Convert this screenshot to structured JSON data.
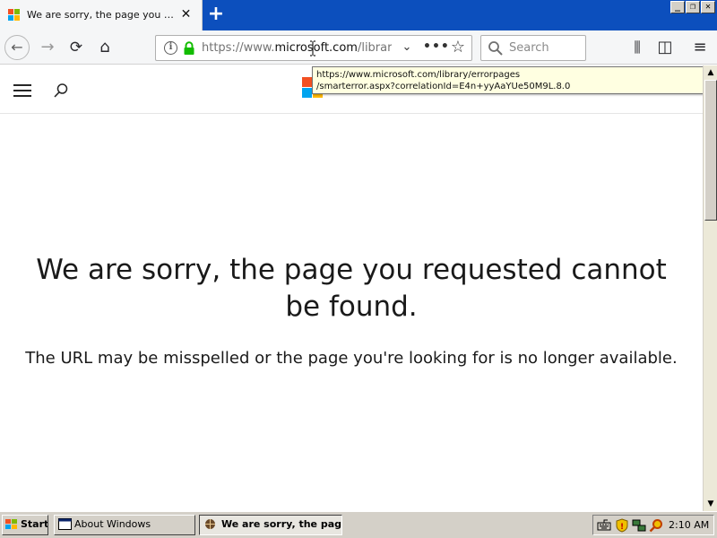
{
  "window": {
    "minimize_glyph": "_",
    "restore_glyph": "❐",
    "close_glyph": "✕"
  },
  "tab": {
    "title": "We are sorry, the page you requested cannot be found.",
    "close_glyph": "✕",
    "new_tab_glyph": "+"
  },
  "toolbar": {
    "back_glyph": "←",
    "forward_glyph": "→",
    "reload_glyph": "⟳",
    "home_glyph": "⌂",
    "info_glyph": "i",
    "url_prefix": "https://www.",
    "url_host": "microsoft.com",
    "url_suffix": "/library/errorpages/smarterror.aspx",
    "url_dropdown_glyph": "⌄",
    "page_actions_glyph": "•••",
    "bookmark_glyph": "☆",
    "search_placeholder": "Search",
    "library_glyph": "⫼",
    "sidebar_glyph": "◫",
    "menu_glyph": "≡"
  },
  "tooltip": {
    "line1": "https://www.microsoft.com/library/errorpages",
    "line2": "/smarterror.aspx?correlationId=E4n+yyAaYUe50M9L.8.0"
  },
  "page": {
    "heading": "We are sorry, the page you requested cannot be found.",
    "message": "The URL may be misspelled or the page you're looking for is no longer available."
  },
  "scrollbar": {
    "up_glyph": "▲",
    "down_glyph": "▼"
  },
  "taskbar": {
    "start_label": "Start",
    "tasks": [
      {
        "label": "About Windows"
      },
      {
        "label": "We are sorry, the pag..."
      }
    ],
    "clock": "2:10 AM"
  },
  "colors": {
    "tabstrip": "#0c4fbd",
    "ms_red": "#f25022",
    "ms_green": "#7fba00",
    "ms_blue": "#00a4ef",
    "ms_yellow": "#ffb900",
    "lock_green": "#12bc00"
  },
  "icons": {
    "site_menu": "hamburger-icon",
    "site_search": "search-icon",
    "site_logo": "microsoft-logo",
    "tray": [
      "keyboard-icon",
      "shield-icon",
      "network-icon",
      "search-icon"
    ]
  }
}
